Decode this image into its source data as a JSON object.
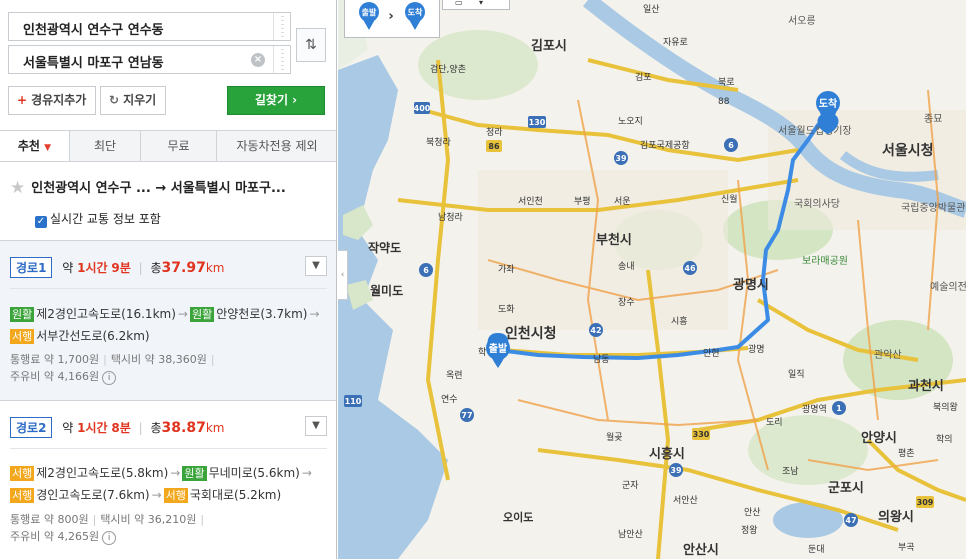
{
  "search": {
    "origin": "인천광역시 연수구 연수동",
    "destination": "서울특별시 마포구 연남동",
    "add_waypoint": "경유지추가",
    "reset": "지우기",
    "find_route": "길찾기"
  },
  "tabs": [
    "추천",
    "최단",
    "무료",
    "자동차전용 제외"
  ],
  "summary": {
    "title": "인천광역시 연수구 ... → 서울특별시 마포구...",
    "realtime_traffic": "실시간 교통 정보 포함"
  },
  "routes": [
    {
      "tag": "경로1",
      "time_prefix": "약 ",
      "time_h": "1시간",
      "time_m": "9분",
      "dist_prefix": "총",
      "dist": "37.97",
      "dist_unit": "km",
      "segments_line1": [
        {
          "badge": "원활",
          "badge_color": "#3aa33a",
          "text": "제2경인고속도로(16.1km)"
        },
        {
          "badge": "원활",
          "badge_color": "#3aa33a",
          "text": "안양천로(3.7km)"
        }
      ],
      "segments_line2": [
        {
          "badge": "서행",
          "badge_color": "#f2a71c",
          "text": "서부간선도로(6.2km)"
        }
      ],
      "toll": "통행료 약 1,700원",
      "taxi": "택시비 약 38,360원",
      "fuel": "주유비 약 4,166원"
    },
    {
      "tag": "경로2",
      "time_prefix": "약 ",
      "time_h": "1시간",
      "time_m": "8분",
      "dist_prefix": "총",
      "dist": "38.87",
      "dist_unit": "km",
      "segments_line1": [
        {
          "badge": "서행",
          "badge_color": "#f2a71c",
          "text": "제2경인고속도로(5.8km)"
        },
        {
          "badge": "원활",
          "badge_color": "#3aa33a",
          "text": "무네미로(5.6km)"
        }
      ],
      "segments_line2": [
        {
          "badge": "서행",
          "badge_color": "#f2a71c",
          "text": "경인고속도로(7.6km)"
        },
        {
          "badge": "서행",
          "badge_color": "#f2a71c",
          "text": "국회대로(5.2km)"
        }
      ],
      "toll": "통행료 약 800원",
      "taxi": "택시비 약 36,210원",
      "fuel": "주유비 약 4,265원"
    }
  ],
  "map": {
    "markers": {
      "start": "출발",
      "end": "도착"
    },
    "cities": [
      "김포시",
      "부천시",
      "광명시",
      "인천시청",
      "서울시청",
      "시흥시",
      "안양시",
      "군포시",
      "의왕시",
      "오이도",
      "안산시",
      "과천시",
      "월미도",
      "작약도"
    ],
    "ic_labels": [
      "일산",
      "자유로",
      "서오릉",
      "검단,양촌",
      "김포",
      "북로",
      "88",
      "노오지",
      "김포국제공항",
      "북청라",
      "청라",
      "서인천",
      "부평",
      "서운",
      "신월",
      "남청라",
      "가좌",
      "송내",
      "도화",
      "장수",
      "시흥",
      "학익",
      "남동",
      "안현",
      "광명",
      "옥련",
      "연수",
      "월곶",
      "광명역",
      "일직",
      "도리",
      "조남",
      "군자",
      "서안산",
      "안산",
      "남안산",
      "정왕",
      "부곡",
      "평촌",
      "북의왕",
      "학의",
      "둔대"
    ],
    "place_labels": [
      "서오릉",
      "종묘",
      "국회의사당",
      "국립중앙박물관",
      "보라매공원",
      "예술의전당",
      "관악산",
      "서울월드컵경기장"
    ],
    "road_numbers": [
      "400",
      "130",
      "86",
      "39",
      "6",
      "42",
      "46",
      "110",
      "77",
      "39",
      "330",
      "1",
      "309",
      "47",
      "6"
    ],
    "colors": {
      "route": "#3c8ce6",
      "marker": "#2f7fd6",
      "water": "#a9c9e4",
      "expressway": "#e8c23a"
    }
  }
}
